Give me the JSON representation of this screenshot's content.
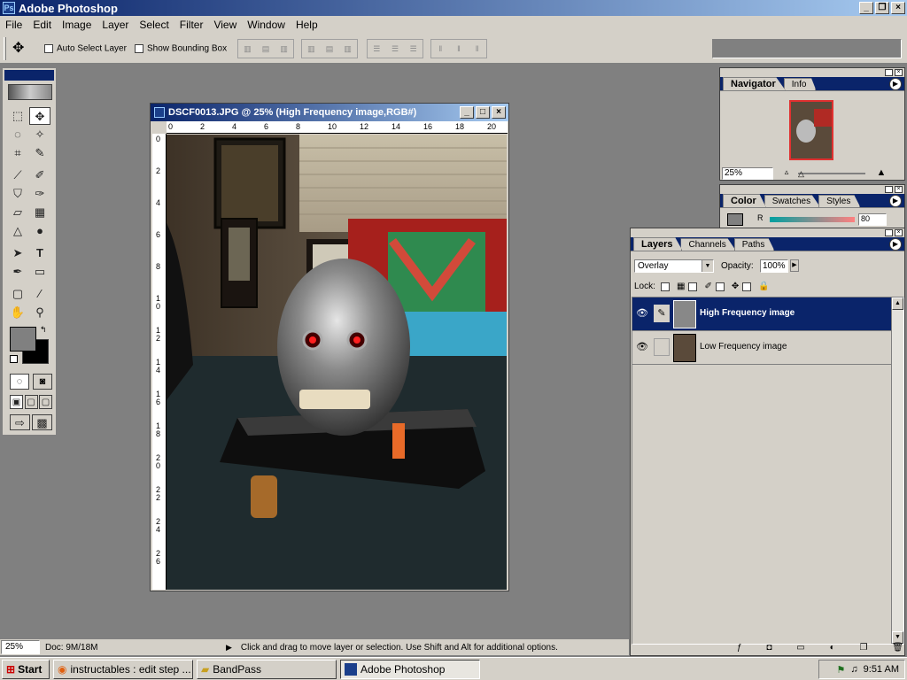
{
  "app": {
    "title": "Adobe Photoshop"
  },
  "menu": [
    "File",
    "Edit",
    "Image",
    "Layer",
    "Select",
    "Filter",
    "View",
    "Window",
    "Help"
  ],
  "options": {
    "auto_select": "Auto Select Layer",
    "bounding_box": "Show Bounding Box"
  },
  "document": {
    "title": "DSCF0013.JPG @ 25% (High Frequency image,RGB#)",
    "hruler": [
      "0",
      "2",
      "4",
      "6",
      "8",
      "10",
      "12",
      "14",
      "16",
      "18",
      "20"
    ],
    "vruler": [
      "0",
      "2",
      "4",
      "6",
      "8",
      "1\n0",
      "1\n2",
      "1\n4",
      "1\n6",
      "1\n8",
      "2\n0",
      "2\n2",
      "2\n4",
      "2\n6"
    ]
  },
  "navigator": {
    "tabs": [
      "Navigator",
      "Info"
    ],
    "zoom": "25%"
  },
  "color": {
    "tabs": [
      "Color",
      "Swatches",
      "Styles"
    ],
    "channel": "R",
    "value": "80"
  },
  "layers": {
    "tabs": [
      "Layers",
      "Channels",
      "Paths"
    ],
    "blend_mode": "Overlay",
    "opacity_label": "Opacity:",
    "opacity": "100%",
    "lock_label": "Lock:",
    "items": [
      {
        "name": "High Frequency image",
        "selected": true
      },
      {
        "name": "Low Frequency image",
        "selected": false
      }
    ]
  },
  "status": {
    "zoom": "25%",
    "doc": "Doc: 9M/18M",
    "hint": "Click and drag to move layer or selection.  Use Shift and Alt for additional options."
  },
  "taskbar": {
    "start": "Start",
    "tasks": [
      "instructables : edit step ...",
      "BandPass",
      "Adobe Photoshop"
    ],
    "time": "9:51 AM"
  },
  "colors": {
    "title_active": "#0a246a",
    "title_gradient_end": "#a6caf0",
    "face": "#d4d0c8",
    "selection": "#0a246a"
  }
}
